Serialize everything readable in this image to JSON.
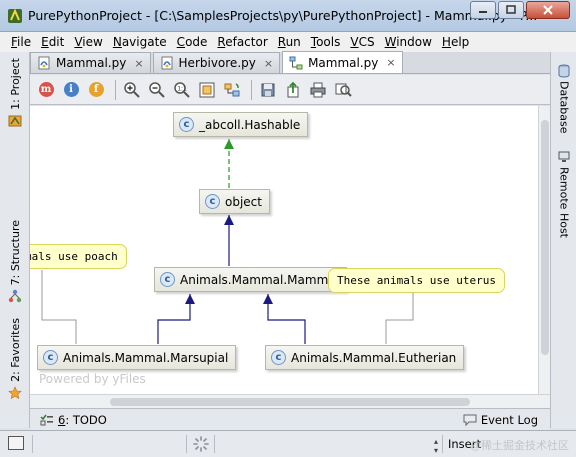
{
  "window": {
    "title": "PurePythonProject - [C:\\SamplesProjects\\py\\PurePythonProject] - Mammal.py - P..."
  },
  "menu": [
    {
      "u": "F",
      "rest": "ile"
    },
    {
      "u": "E",
      "rest": "dit"
    },
    {
      "u": "V",
      "rest": "iew"
    },
    {
      "u": "N",
      "rest": "avigate"
    },
    {
      "u": "C",
      "rest": "ode"
    },
    {
      "u": "R",
      "rest": "efactor"
    },
    {
      "u": "R",
      "rest": "un"
    },
    {
      "u": "T",
      "rest": "ools"
    },
    {
      "u": "V",
      "rest": "CS"
    },
    {
      "u": "W",
      "rest": "indow"
    },
    {
      "u": "H",
      "rest": "elp"
    }
  ],
  "left_tabs": {
    "project": "1: Project",
    "structure": "7: Structure",
    "favorites": "2: Favorites"
  },
  "right_tabs": {
    "database": "Database",
    "remote_host": "Remote Host"
  },
  "editor_tabs": [
    {
      "label": "Mammal.py",
      "icon": "python-file-icon",
      "active": false
    },
    {
      "label": "Herbivore.py",
      "icon": "python-file-icon",
      "active": false
    },
    {
      "label": "Mammal.py",
      "icon": "diagram-file-icon",
      "active": true
    }
  ],
  "diagram_toolbar": {
    "toggles": [
      {
        "letter": "m",
        "color": "#d9534a",
        "icon": "methods-icon"
      },
      {
        "letter": "i",
        "color": "#4a7fc8",
        "icon": "info-icon"
      },
      {
        "letter": "f",
        "color": "#e8a22c",
        "icon": "fields-icon"
      }
    ]
  },
  "diagram": {
    "nodes": {
      "hashable": "_abcoll.Hashable",
      "object": "object",
      "mammal": "Animals.Mammal.Mammal",
      "marsupial": "Animals.Mammal.Marsupial",
      "eutherian": "Animals.Mammal.Eutherian"
    },
    "notes": {
      "poach": "mals use poach",
      "uterus": "These animals use uterus"
    },
    "watermark": "Powered by yFiles",
    "class_badge": "c"
  },
  "bottom_bar": {
    "todo_num": "6",
    "todo_label": ": TODO",
    "event_log": "Event Log"
  },
  "status": {
    "insert_mode": "Insert",
    "overlay_text": "@稀土掘金技术社区"
  }
}
